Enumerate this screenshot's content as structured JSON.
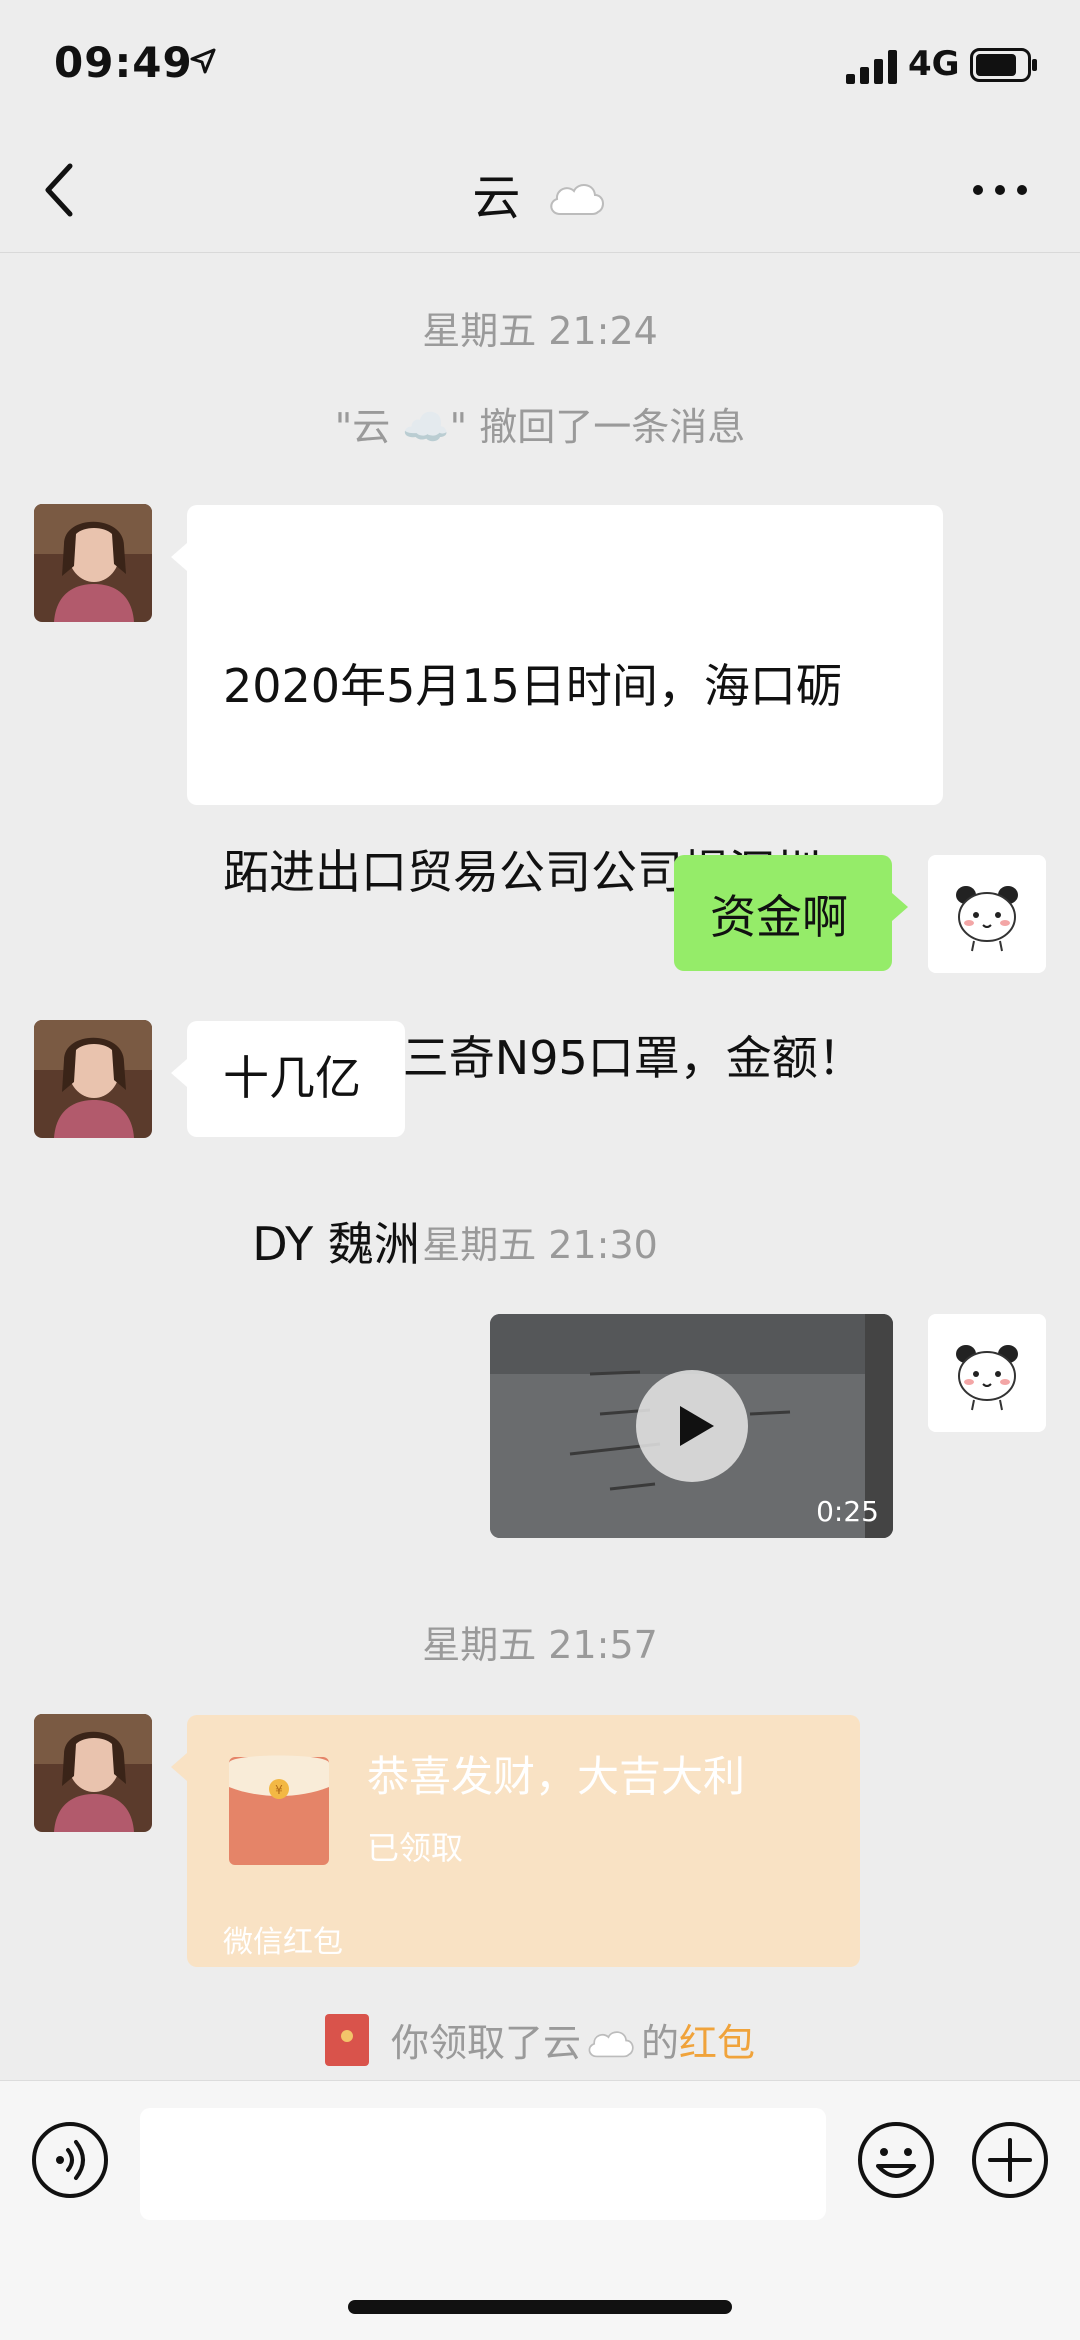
{
  "status_bar": {
    "time": "09:49",
    "network": "4G"
  },
  "header": {
    "title": "云",
    "title_emoji": "cloud-icon"
  },
  "chat": {
    "timestamp_1": "星期五 21:24",
    "recall_notice": "\"云 ☁️\" 撤回了一条消息",
    "msg_1_lines": [
      "2020年5月15日时间，海口砺",
      "跖进出口贸易公司公司提深圳",
      "200万只三奇N95口罩，金额！",
      "  DY 魏洲"
    ],
    "msg_2": "资金啊",
    "msg_3": "十几亿",
    "timestamp_2": "星期五 21:30",
    "video_duration": "0:25",
    "timestamp_3": "星期五 21:57",
    "red_packet": {
      "greeting": "恭喜发财，大吉大利",
      "status": "已领取",
      "footer": "微信红包"
    },
    "receipt_notice": {
      "prefix": "你领取了云",
      "middle": "的",
      "link": "红包"
    }
  },
  "colors": {
    "accent_green": "#95ec69",
    "red_packet": "#f9e2c4",
    "link_orange": "#f0a33b"
  }
}
